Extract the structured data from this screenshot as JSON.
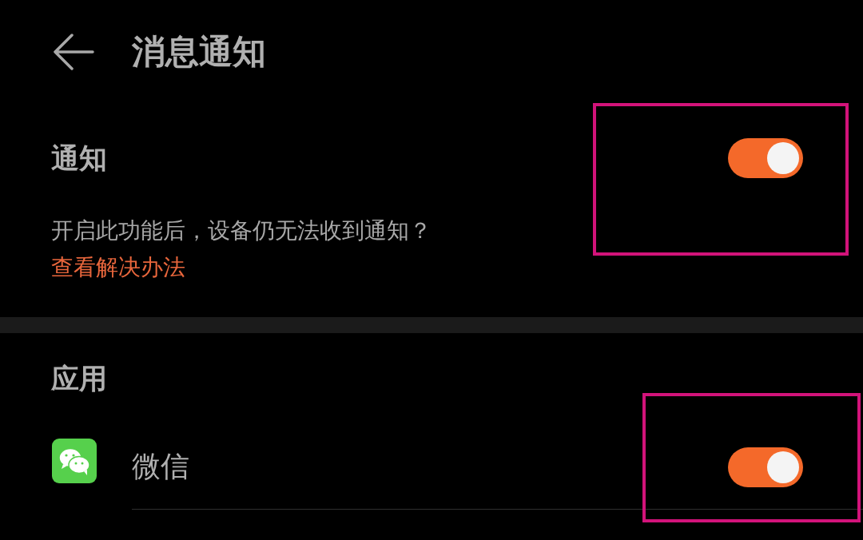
{
  "header": {
    "title": "消息通知"
  },
  "notification": {
    "label": "通知",
    "on": true,
    "description": "开启此功能后，设备仍无法收到通知？",
    "link": "查看解决办法"
  },
  "apps_section": {
    "title": "应用",
    "items": [
      {
        "name": "微信",
        "on": true
      }
    ]
  }
}
